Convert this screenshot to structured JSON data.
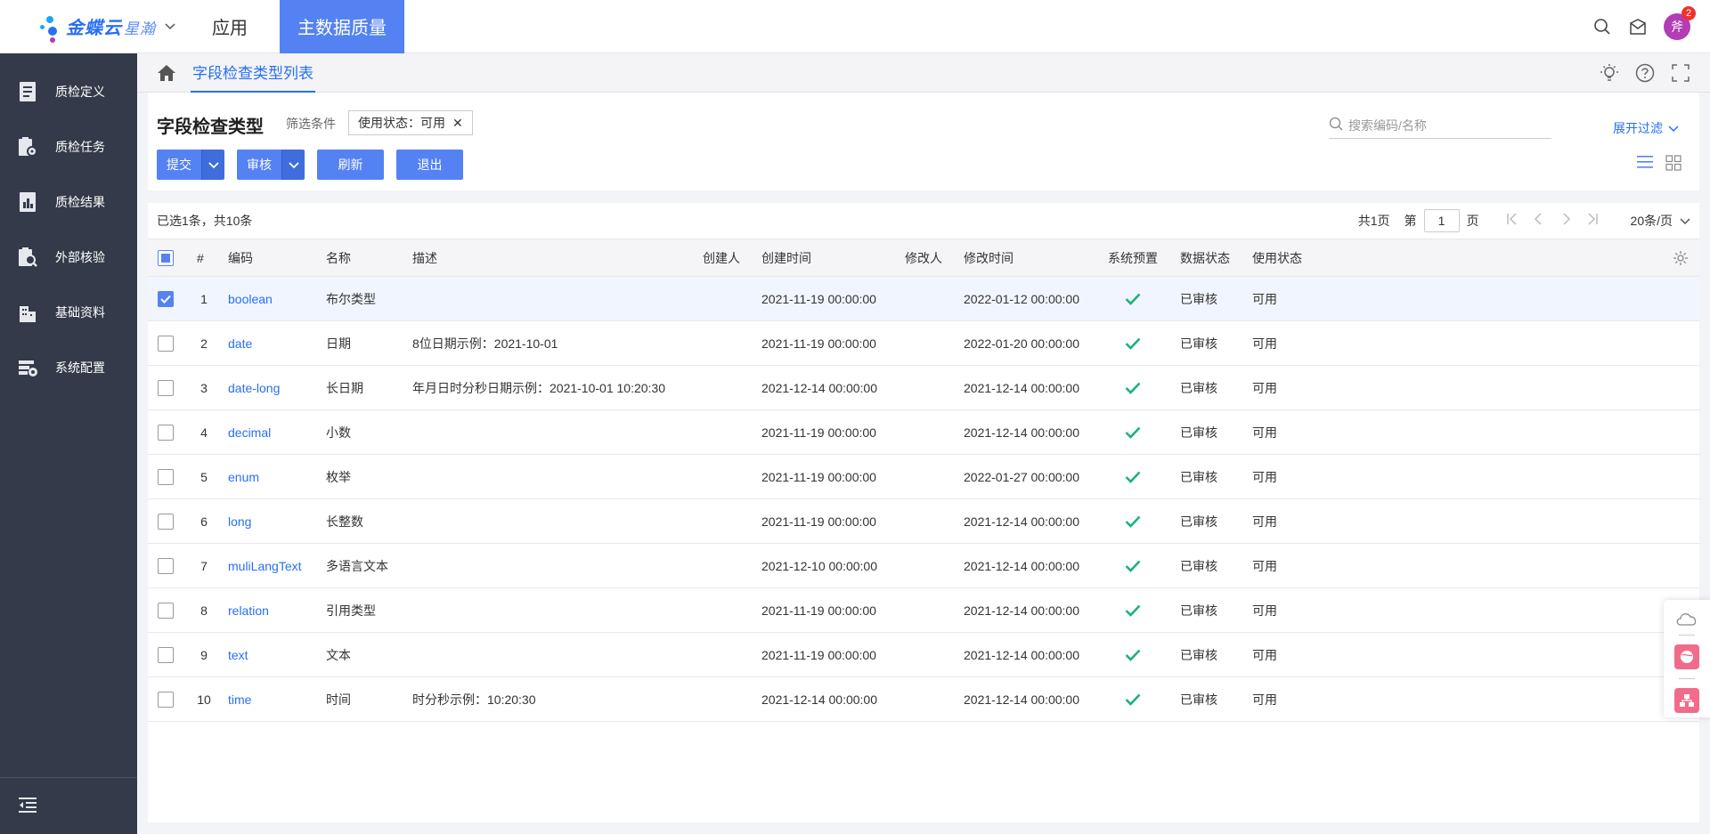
{
  "topbar": {
    "brand": "金蝶云",
    "brand_sub": "星瀚",
    "app_menu": "应用",
    "active_tab": "主数据质量",
    "avatar_text": "斧",
    "notification_count": "2"
  },
  "sidebar": {
    "items": [
      {
        "label": "质检定义",
        "icon": "document-icon"
      },
      {
        "label": "质检任务",
        "icon": "task-gear-icon"
      },
      {
        "label": "质检结果",
        "icon": "result-chart-icon"
      },
      {
        "label": "外部核验",
        "icon": "search-doc-icon"
      },
      {
        "label": "基础资料",
        "icon": "building-icon"
      },
      {
        "label": "系统配置",
        "icon": "config-gear-icon"
      }
    ]
  },
  "breadcrumb": {
    "current": "字段检查类型列表"
  },
  "header": {
    "title": "字段检查类型",
    "filter_label": "筛选条件",
    "filter_chip": "使用状态：可用",
    "search_placeholder": "搜索编码/名称",
    "expand_filter": "展开过滤",
    "buttons": {
      "submit": "提交",
      "audit": "审核",
      "refresh": "刷新",
      "exit": "退出"
    }
  },
  "table": {
    "selection_info": "已选1条，共10条",
    "pager": {
      "total_pages": "共1页",
      "page_prefix": "第",
      "page_value": "1",
      "page_suffix": "页",
      "page_size": "20条/页"
    },
    "columns": {
      "index": "#",
      "code": "编码",
      "name": "名称",
      "desc": "描述",
      "creator": "创建人",
      "created": "创建时间",
      "modifier": "修改人",
      "modified": "修改时间",
      "preset": "系统预置",
      "data_status": "数据状态",
      "use_status": "使用状态"
    },
    "rows": [
      {
        "index": "1",
        "code": "boolean",
        "name": "布尔类型",
        "desc": "",
        "created": "2021-11-19 00:00:00",
        "modified": "2022-01-12 00:00:00",
        "data_status": "已审核",
        "use_status": "可用",
        "selected": true
      },
      {
        "index": "2",
        "code": "date",
        "name": "日期",
        "desc": "8位日期示例：2021-10-01",
        "created": "2021-11-19 00:00:00",
        "modified": "2022-01-20 00:00:00",
        "data_status": "已审核",
        "use_status": "可用",
        "selected": false
      },
      {
        "index": "3",
        "code": "date-long",
        "name": "长日期",
        "desc": "年月日时分秒日期示例：2021-10-01 10:20:30",
        "created": "2021-12-14 00:00:00",
        "modified": "2021-12-14 00:00:00",
        "data_status": "已审核",
        "use_status": "可用",
        "selected": false
      },
      {
        "index": "4",
        "code": "decimal",
        "name": "小数",
        "desc": "",
        "created": "2021-11-19 00:00:00",
        "modified": "2021-12-14 00:00:00",
        "data_status": "已审核",
        "use_status": "可用",
        "selected": false
      },
      {
        "index": "5",
        "code": "enum",
        "name": "枚举",
        "desc": "",
        "created": "2021-11-19 00:00:00",
        "modified": "2022-01-27 00:00:00",
        "data_status": "已审核",
        "use_status": "可用",
        "selected": false
      },
      {
        "index": "6",
        "code": "long",
        "name": "长整数",
        "desc": "",
        "created": "2021-11-19 00:00:00",
        "modified": "2021-12-14 00:00:00",
        "data_status": "已审核",
        "use_status": "可用",
        "selected": false
      },
      {
        "index": "7",
        "code": "muliLangText",
        "name": "多语言文本",
        "desc": "",
        "created": "2021-12-10 00:00:00",
        "modified": "2021-12-14 00:00:00",
        "data_status": "已审核",
        "use_status": "可用",
        "selected": false
      },
      {
        "index": "8",
        "code": "relation",
        "name": "引用类型",
        "desc": "",
        "created": "2021-11-19 00:00:00",
        "modified": "2021-12-14 00:00:00",
        "data_status": "已审核",
        "use_status": "可用",
        "selected": false
      },
      {
        "index": "9",
        "code": "text",
        "name": "文本",
        "desc": "",
        "created": "2021-11-19 00:00:00",
        "modified": "2021-12-14 00:00:00",
        "data_status": "已审核",
        "use_status": "可用",
        "selected": false
      },
      {
        "index": "10",
        "code": "time",
        "name": "时间",
        "desc": "时分秒示例：10:20:30",
        "created": "2021-12-14 00:00:00",
        "modified": "2021-12-14 00:00:00",
        "data_status": "已审核",
        "use_status": "可用",
        "selected": false
      }
    ]
  },
  "colors": {
    "accent": "#5582f3",
    "link": "#276ff5",
    "sidebar_bg": "#343a4a",
    "check_green": "#1ab37a"
  }
}
